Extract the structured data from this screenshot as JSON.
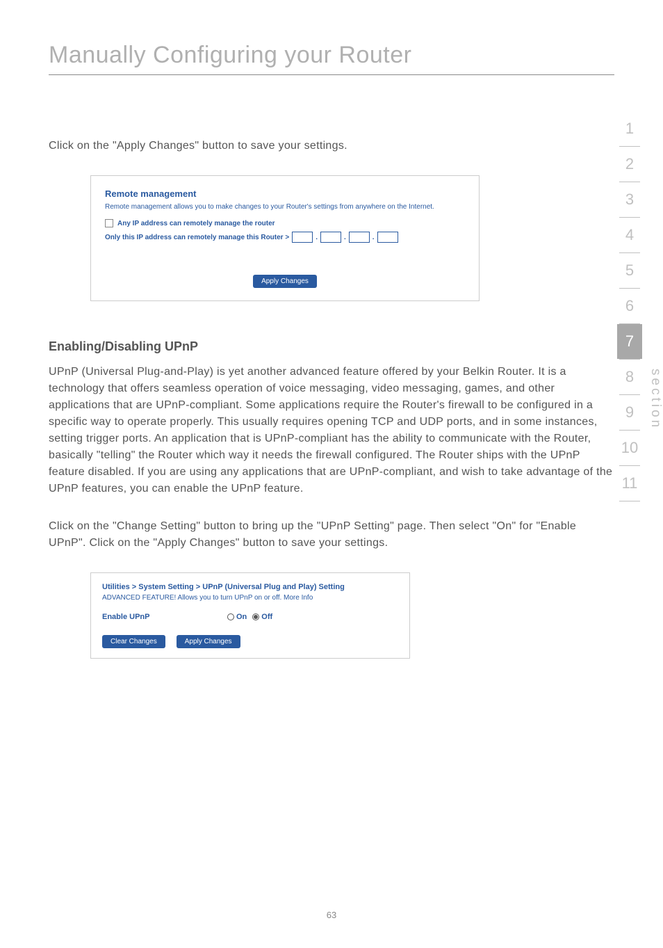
{
  "page": {
    "title": "Manually Configuring your Router",
    "pageNumber": "63"
  },
  "intro": "Click on the \"Apply Changes\" button to save your settings.",
  "screenshot1": {
    "title": "Remote management",
    "desc": "Remote management allows you to make changes to your Router's settings from anywhere on the Internet.",
    "checkboxLabel": "Any IP address can remotely manage the router",
    "ipLabel": "Only this IP address can remotely manage this Router >",
    "applyButton": "Apply Changes"
  },
  "section": {
    "heading": "Enabling/Disabling UPnP",
    "para1": "UPnP (Universal Plug-and-Play) is yet another advanced feature offered by your Belkin Router. It is a technology that offers seamless operation of voice messaging, video messaging, games, and other applications that are UPnP-compliant. Some applications require the Router's firewall to be configured in a specific way to operate properly. This usually requires opening TCP and UDP ports, and in some instances, setting trigger ports. An application that is UPnP-compliant has the ability to communicate with the Router, basically \"telling\" the Router which way it needs the firewall configured. The Router ships with the UPnP feature disabled. If you are using any applications that are UPnP-compliant, and wish to take advantage of the UPnP features, you can enable the UPnP feature.",
    "para2": "Click on the \"Change Setting\" button to bring up the \"UPnP Setting\" page. Then select \"On\" for \"Enable UPnP\". Click on the \"Apply Changes\" button to save your settings."
  },
  "screenshot2": {
    "title": "Utilities > System Setting > UPnP (Universal Plug and Play) Setting",
    "desc": "ADVANCED FEATURE! Allows you to turn UPnP on or off. More Info",
    "enableLabel": "Enable UPnP",
    "onLabel": "On",
    "offLabel": "Off",
    "clearButton": "Clear Changes",
    "applyButton": "Apply Changes"
  },
  "nav": {
    "items": [
      "1",
      "2",
      "3",
      "4",
      "5",
      "6",
      "7",
      "8",
      "9",
      "10",
      "11"
    ],
    "activeIndex": 6,
    "sectionLabel": "section"
  }
}
